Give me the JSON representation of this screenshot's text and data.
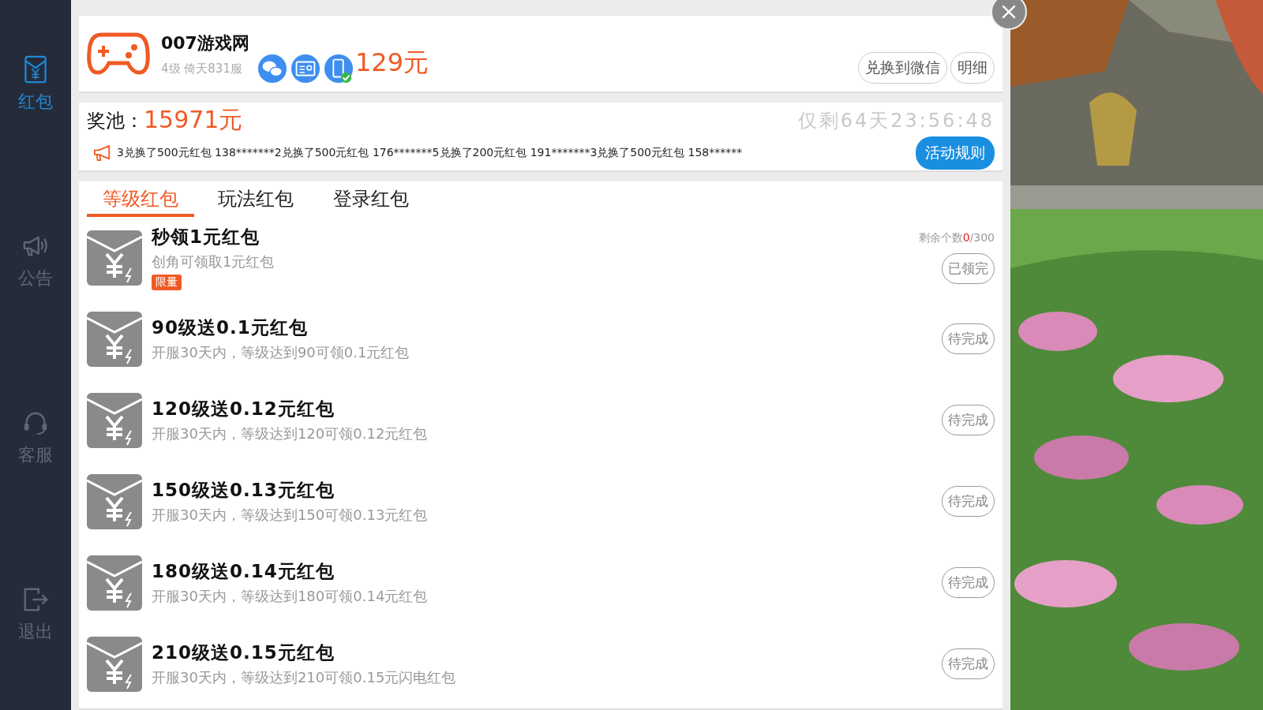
{
  "sidebar": {
    "items": [
      {
        "label": "红包",
        "kind": "envelope",
        "selected": true
      },
      {
        "label": "公告",
        "kind": "megaphone",
        "selected": false
      },
      {
        "label": "客服",
        "kind": "headset",
        "selected": false
      },
      {
        "label": "退出",
        "kind": "exit",
        "selected": false
      }
    ]
  },
  "account": {
    "name": "007游戏网",
    "info": "4级 倚天831服",
    "phone_verified": true,
    "balance": "129元",
    "buttons": [
      "兑换到微信",
      "明细"
    ]
  },
  "pool": {
    "label": "奖池：",
    "amount": "15971元",
    "countdown": "仅剩64天23:56:48",
    "ticker": "3兑换了500元红包 138*******2兑换了500元红包 176*******5兑换了200元红包 191*******3兑换了500元红包 158******",
    "rules_button": "活动规则"
  },
  "tabs": [
    {
      "label": "等级红包",
      "selected": true
    },
    {
      "label": "玩法红包",
      "selected": false
    },
    {
      "label": "登录红包",
      "selected": false
    }
  ],
  "rewards": [
    {
      "title": "秒领1元红包",
      "desc": "创角可领取1元红包",
      "badge": "限量",
      "remaining": {
        "label": "剩余个数",
        "count": "0",
        "total": "/300"
      },
      "button": "已领完"
    },
    {
      "title": "90级送0.1元红包",
      "desc": "开服30天内，等级达到90可领0.1元红包",
      "button": "待完成"
    },
    {
      "title": "120级送0.12元红包",
      "desc": "开服30天内，等级达到120可领0.12元红包",
      "button": "待完成"
    },
    {
      "title": "150级送0.13元红包",
      "desc": "开服30天内，等级达到150可领0.13元红包",
      "button": "待完成"
    },
    {
      "title": "180级送0.14元红包",
      "desc": "开服30天内，等级达到180可领0.14元红包",
      "button": "待完成"
    },
    {
      "title": "210级送0.15元红包",
      "desc": "开服30天内，等级达到210可领0.15元闪电红包",
      "button": "待完成"
    }
  ]
}
